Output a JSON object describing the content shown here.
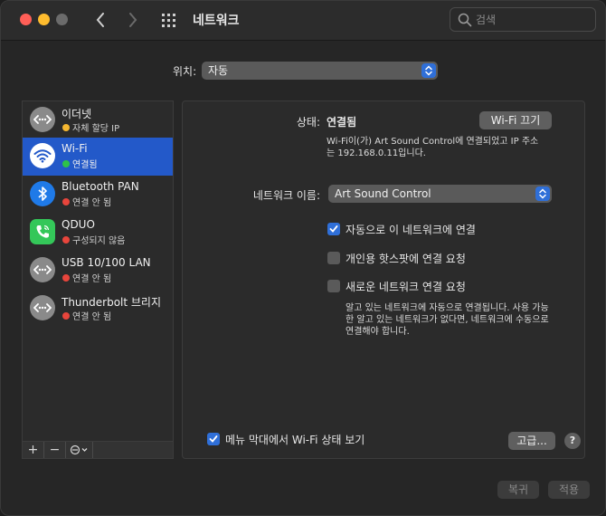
{
  "window": {
    "title": "네트워크"
  },
  "search": {
    "placeholder": "검색"
  },
  "location": {
    "label": "위치:",
    "value": "자동"
  },
  "services": [
    {
      "name": "이더넷",
      "status": "자체 할당 IP",
      "status_color": "#f5b731",
      "icon": "ethernet-icon"
    },
    {
      "name": "Wi-Fi",
      "status": "연결됨",
      "status_color": "#2ec24a",
      "icon": "wifi-icon"
    },
    {
      "name": "Bluetooth PAN",
      "status": "연결 안 됨",
      "status_color": "#e8453c",
      "icon": "bluetooth-icon"
    },
    {
      "name": "QDUO",
      "status": "구성되지 않음",
      "status_color": "#e8453c",
      "icon": "phone-icon"
    },
    {
      "name": "USB 10/100 LAN",
      "status": "연결 안 됨",
      "status_color": "#e8453c",
      "icon": "ethernet-icon"
    },
    {
      "name": "Thunderbolt 브리지",
      "status": "연결 안 됨",
      "status_color": "#e8453c",
      "icon": "ethernet-icon"
    }
  ],
  "sidebar_buttons": {
    "add": "+",
    "remove": "−"
  },
  "detail": {
    "status_label": "상태:",
    "status_value": "연결됨",
    "wifi_off_button": "Wi-Fi 끄기",
    "status_description": "Wi-Fi이(가) Art Sound Control에 연결되었고 IP 주소는 192.168.0.11입니다.",
    "network_name_label": "네트워크 이름:",
    "network_name_value": "Art Sound Control",
    "auto_join_label": "자동으로 이 네트워크에 연결",
    "hotspot_label": "개인용 핫스팟에 연결 요청",
    "ask_new_label": "새로운 네트워크 연결 요청",
    "ask_new_description": "알고 있는 네트워크에 자동으로 연결됩니다. 사용 가능한 알고 있는 네트워크가 없다면, 네트워크에 수동으로 연결해야 합니다.",
    "show_menu_label": "메뉴 막대에서 Wi-Fi 상태 보기",
    "advanced_button": "고급...",
    "help_button": "?"
  },
  "footer": {
    "revert_button": "복귀",
    "apply_button": "적용"
  },
  "colors": {
    "accent": "#2f6fd8",
    "selection": "#2359c9"
  }
}
